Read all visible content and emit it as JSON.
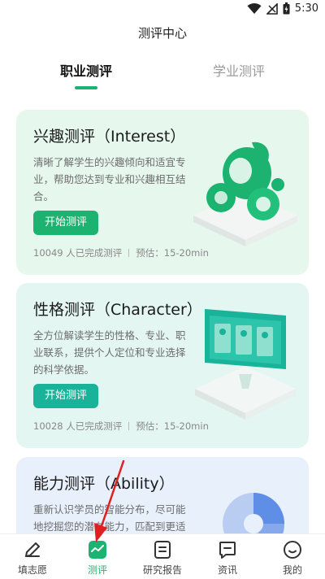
{
  "status_bar": {
    "time": "5:30"
  },
  "page_title": "测评中心",
  "tabs": [
    {
      "label": "职业测评",
      "active": true
    },
    {
      "label": "学业测评",
      "active": false
    }
  ],
  "cards": [
    {
      "title": "兴趣测评（Interest）",
      "description": "清晰了解学生的兴趣倾向和适宜专业，帮助您达到专业和兴趣相互结合。",
      "button": "开始测评",
      "completed": "10049 人已完成测评",
      "estimate": "预估：15-20min"
    },
    {
      "title": "性格测评（Character）",
      "description": "全方位解读学生的性格、专业、职业联系，提供个人定位和专业选择的科学依据。",
      "button": "开始测评",
      "completed": "10028 人已完成测评",
      "estimate": "预估：15-20min"
    },
    {
      "title": "能力测评（Ability）",
      "description": "重新认识学员的智能分布，尽可能地挖掘您的潜在能力，匹配到更适合您的专业。"
    }
  ],
  "bottom_nav": [
    {
      "label": "填志愿",
      "icon": "pencil-icon",
      "active": false
    },
    {
      "label": "测评",
      "icon": "chart-icon",
      "active": true
    },
    {
      "label": "研究报告",
      "icon": "report-icon",
      "active": false
    },
    {
      "label": "资讯",
      "icon": "message-icon",
      "active": false
    },
    {
      "label": "我的",
      "icon": "smile-icon",
      "active": false
    }
  ],
  "colors": {
    "accent": "#1bb36f",
    "accent_teal": "#19b39a",
    "annotation_arrow": "#e02020"
  }
}
